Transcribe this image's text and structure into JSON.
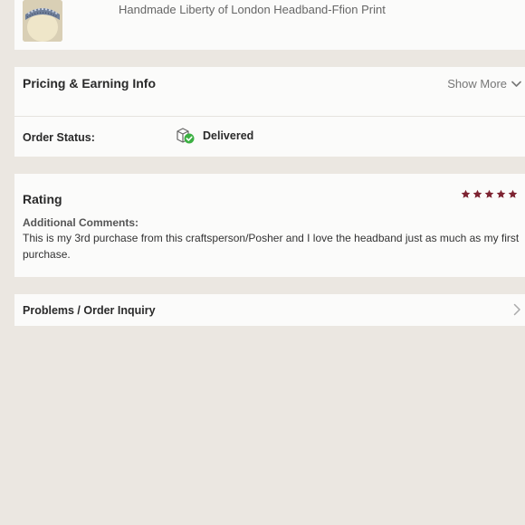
{
  "product": {
    "title": "Handmade Liberty of London Headband-Ffion Print",
    "thumbnail_icon": "headband-photo"
  },
  "pricing": {
    "title": "Pricing & Earning Info",
    "show_more_label": "Show More",
    "show_more_icon": "chevron-down-icon"
  },
  "order_status": {
    "label": "Order Status:",
    "value": "Delivered",
    "icon": "delivered-box-check-icon"
  },
  "rating": {
    "title": "Rating",
    "stars": 5,
    "max_stars": 5,
    "star_color": "#7d2331",
    "comments_label": "Additional Comments:",
    "comments_text": "This is my 3rd purchase from this craftsperson/Posher and I love the headband just as much as my first purchase."
  },
  "problems": {
    "label": "Problems / Order Inquiry",
    "icon": "chevron-right-icon"
  },
  "colors": {
    "background": "#ebe7e1",
    "card": "#fbfbfa",
    "delivered_check": "#3cb043"
  }
}
